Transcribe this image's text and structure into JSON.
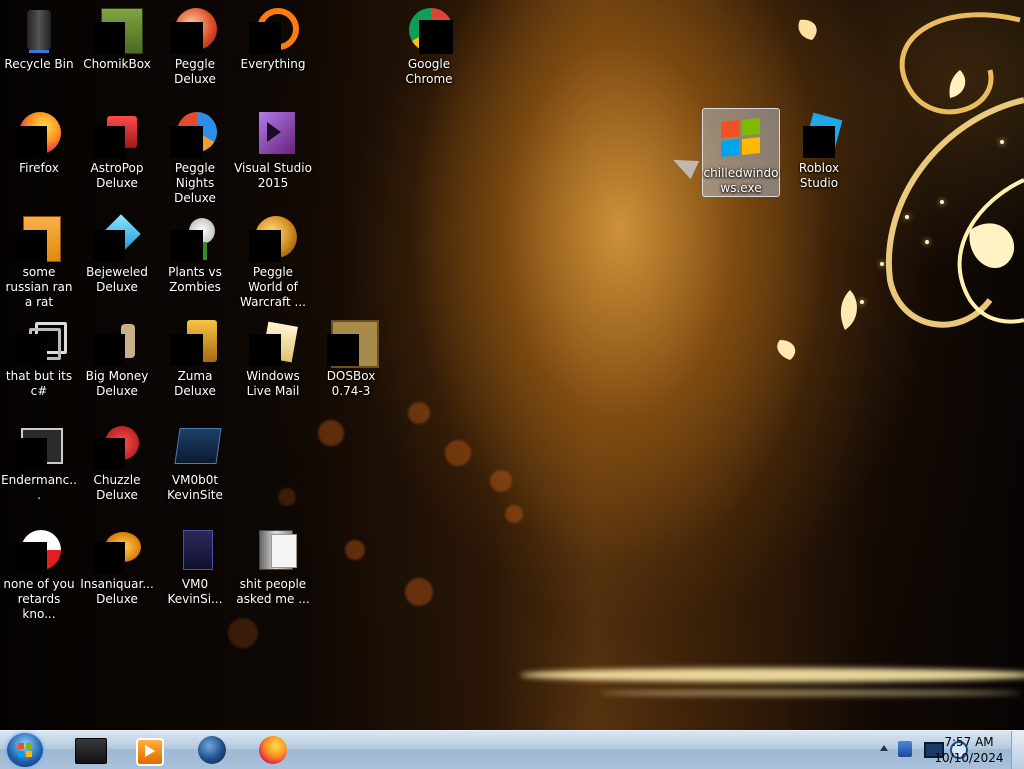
{
  "desktop": {
    "icons": [
      {
        "label": "Recycle Bin",
        "icon": "recycle-bin-icon"
      },
      {
        "label": "ChomikBox",
        "icon": "chomikbox-icon"
      },
      {
        "label": "Peggle Deluxe",
        "icon": "peggle-icon"
      },
      {
        "label": "Everything",
        "icon": "everything-icon"
      },
      {
        "label": "Google Chrome",
        "icon": "chrome-icon"
      },
      {
        "label": "Firefox",
        "icon": "firefox-icon"
      },
      {
        "label": "AstroPop Deluxe",
        "icon": "astropop-icon"
      },
      {
        "label": "Peggle Nights Deluxe",
        "icon": "peggle-nights-icon"
      },
      {
        "label": "Visual Studio 2015",
        "icon": "visual-studio-icon"
      },
      {
        "label": "chilledwindows.exe",
        "icon": "windows-logo-icon"
      },
      {
        "label": "Roblox Studio",
        "icon": "roblox-studio-icon"
      },
      {
        "label": "some russian ran a rat",
        "icon": "file-icon"
      },
      {
        "label": "Bejeweled Deluxe",
        "icon": "bejeweled-icon"
      },
      {
        "label": "Plants vs Zombies",
        "icon": "plants-vs-zombies-icon"
      },
      {
        "label": "Peggle World of Warcraft ...",
        "icon": "peggle-wow-icon"
      },
      {
        "label": "that but its c#",
        "icon": "shortcut-icon"
      },
      {
        "label": "Big Money Deluxe",
        "icon": "big-money-icon"
      },
      {
        "label": "Zuma Deluxe",
        "icon": "zuma-icon"
      },
      {
        "label": "Windows Live Mail",
        "icon": "mail-icon"
      },
      {
        "label": "DOSBox 0.74-3",
        "icon": "dosbox-icon"
      },
      {
        "label": "Endermanc...",
        "icon": "app-window-icon"
      },
      {
        "label": "Chuzzle Deluxe",
        "icon": "chuzzle-icon"
      },
      {
        "label": "VM0b0t KevinSite",
        "icon": "vm-icon"
      },
      {
        "label": "none of you retards kno...",
        "icon": "swirl-icon"
      },
      {
        "label": "Insaniquar... Deluxe",
        "icon": "insaniquarium-icon"
      },
      {
        "label": "VM0 KevinSi...",
        "icon": "vm-file-icon"
      },
      {
        "label": "shit people asked me ...",
        "icon": "folder-icon"
      }
    ]
  },
  "taskbar": {
    "pinned": [
      "file-explorer-icon",
      "media-player-icon",
      "globe-icon",
      "firefox-icon"
    ],
    "tray": [
      "show-hidden-icons-icon",
      "network-icon",
      "monitor-icon",
      "volume-icon"
    ],
    "time": "7:57 AM",
    "date": "10/10/2024"
  }
}
